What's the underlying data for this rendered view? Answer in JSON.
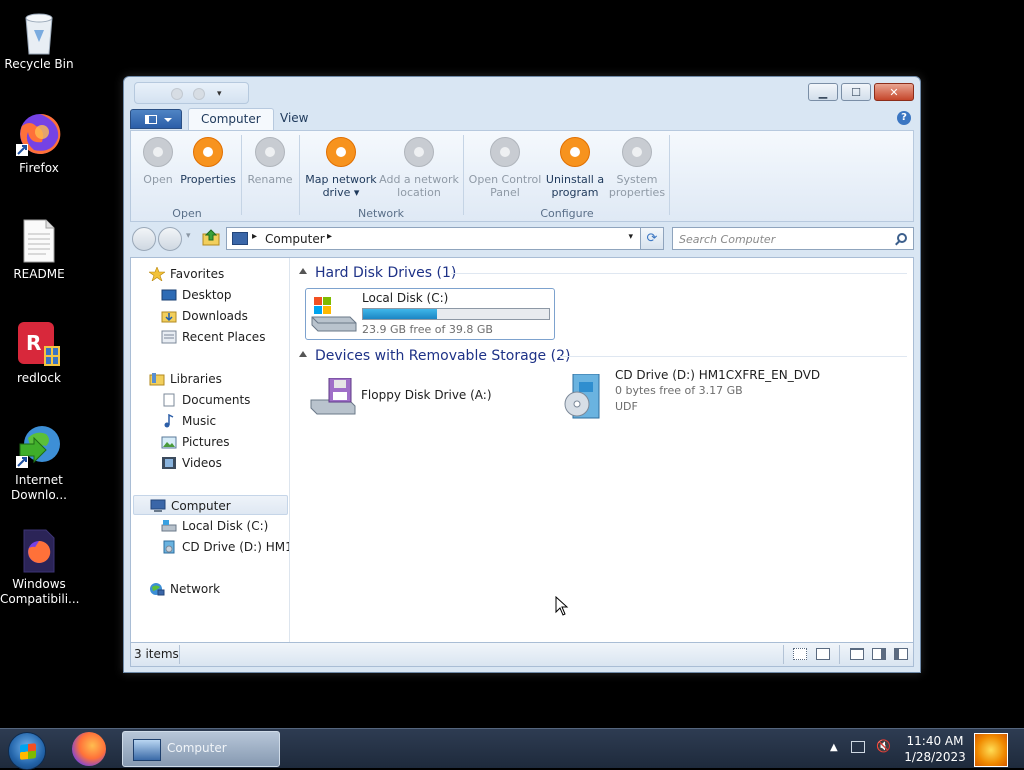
{
  "desktop": {
    "icons": [
      {
        "label": "Recycle Bin",
        "icon": "recycle-bin-icon"
      },
      {
        "label": "Firefox",
        "icon": "firefox-icon"
      },
      {
        "label": "README",
        "icon": "text-file-icon"
      },
      {
        "label": "redlock",
        "icon": "redlock-icon"
      },
      {
        "label": "Internet Downlo...",
        "icon": "internet-download-manager-icon"
      },
      {
        "label": "Windows Compatibili...",
        "icon": "windows-compatibility-icon"
      }
    ]
  },
  "window": {
    "title": "Computer",
    "controls": {
      "minimize": "▁",
      "maximize": "☐",
      "close": "✕"
    },
    "ribbon_tabs": [
      {
        "label": "Computer",
        "active": true
      },
      {
        "label": "View",
        "active": false
      }
    ],
    "ribbon": {
      "groups": [
        {
          "label": "Open",
          "buttons": [
            {
              "label": "Open",
              "enabled": false
            },
            {
              "label": "Properties",
              "enabled": true
            }
          ]
        },
        {
          "label": "",
          "buttons": [
            {
              "label": "Rename",
              "enabled": false
            }
          ]
        },
        {
          "label": "Network",
          "buttons": [
            {
              "label": "Map network drive ▾",
              "enabled": true
            },
            {
              "label": "Add a network location",
              "enabled": false
            }
          ]
        },
        {
          "label": "Configure",
          "buttons": [
            {
              "label": "Open Control Panel",
              "enabled": false
            },
            {
              "label": "Uninstall a program",
              "enabled": true
            },
            {
              "label": "System properties",
              "enabled": false
            }
          ]
        }
      ]
    },
    "address": {
      "path": "Computer",
      "separator": "▸"
    },
    "search": {
      "placeholder": "Search Computer"
    },
    "nav_pane": {
      "favorites": {
        "label": "Favorites",
        "items": [
          "Desktop",
          "Downloads",
          "Recent Places"
        ]
      },
      "libraries": {
        "label": "Libraries",
        "items": [
          "Documents",
          "Music",
          "Pictures",
          "Videos"
        ]
      },
      "computer": {
        "label": "Computer",
        "items": [
          "Local Disk (C:)",
          "CD Drive (D:) HM1C"
        ]
      },
      "network": {
        "label": "Network"
      }
    },
    "groups": [
      {
        "header": "Hard Disk Drives (1)",
        "items": [
          {
            "name": "Local Disk (C:)",
            "detail": "23.9 GB free of 39.8 GB",
            "used_fraction": 0.4
          }
        ]
      },
      {
        "header": "Devices with Removable Storage (2)",
        "items": [
          {
            "name": "Floppy Disk Drive (A:)"
          },
          {
            "name": "CD Drive (D:) HM1CXFRE_EN_DVD",
            "detail": "0 bytes free of 3.17 GB",
            "fs": "UDF"
          }
        ]
      }
    ],
    "status": {
      "items": "3 items"
    }
  },
  "taskbar": {
    "active_task": "Computer",
    "time": "11:40 AM",
    "date": "1/28/2023"
  }
}
